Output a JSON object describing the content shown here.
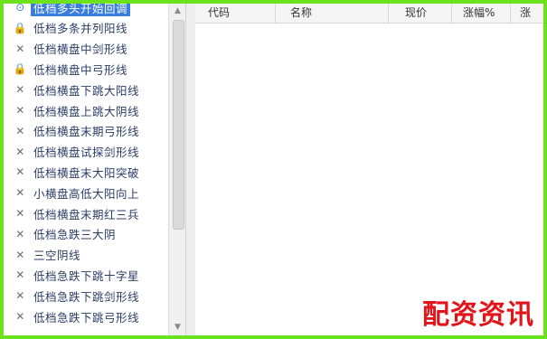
{
  "tree": {
    "items": [
      {
        "label": "低档多头开始回调",
        "icon": "check-icon",
        "selected": true
      },
      {
        "label": "低档多条并列阳线",
        "icon": "lock-icon"
      },
      {
        "label": "低档横盘中剑形线",
        "icon": "close-icon"
      },
      {
        "label": "低档横盘中弓形线",
        "icon": "lock-icon"
      },
      {
        "label": "低档横盘下跳大阳线",
        "icon": "close-icon"
      },
      {
        "label": "低档横盘上跳大阴线",
        "icon": "close-icon"
      },
      {
        "label": "低档横盘末期弓形线",
        "icon": "close-icon"
      },
      {
        "label": "低档横盘试探剑形线",
        "icon": "close-icon"
      },
      {
        "label": "低档横盘末大阳突破",
        "icon": "close-icon"
      },
      {
        "label": "小横盘高低大阳向上",
        "icon": "close-icon"
      },
      {
        "label": "低档横盘末期红三兵",
        "icon": "close-icon"
      },
      {
        "label": "低档急跌三大阴",
        "icon": "close-icon"
      },
      {
        "label": "三空阴线",
        "icon": "close-icon"
      },
      {
        "label": "低档急跌下跳十字星",
        "icon": "close-icon"
      },
      {
        "label": "低档急跌下跳剑形线",
        "icon": "close-icon"
      },
      {
        "label": "低档急跌下跳弓形线",
        "icon": "close-icon"
      }
    ]
  },
  "table": {
    "headers": [
      "代码",
      "名称",
      "现价",
      "涨幅%",
      "涨"
    ]
  },
  "watermark": "配资资讯"
}
